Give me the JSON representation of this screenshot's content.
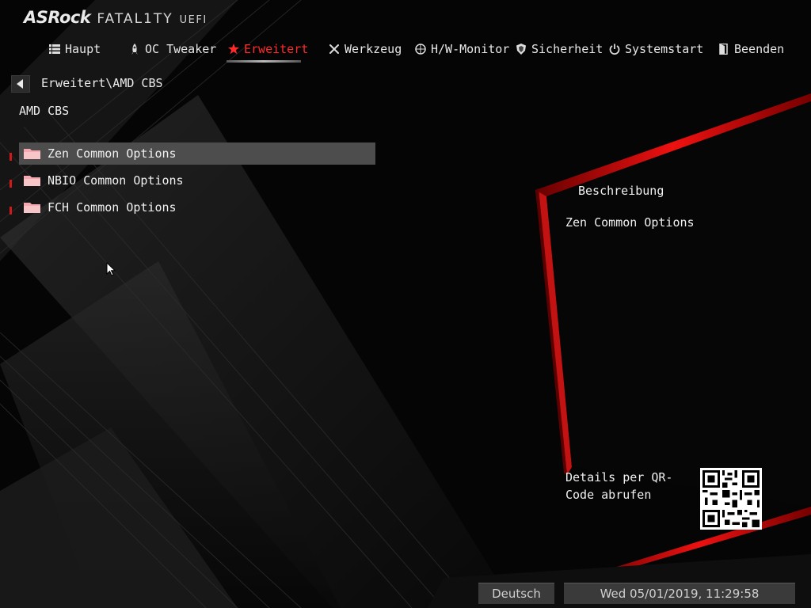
{
  "logo": {
    "brand": "ASRock",
    "line": "FATAL1TY",
    "sub": "UEFI"
  },
  "tabs": [
    {
      "label": "Haupt",
      "icon": "list-icon"
    },
    {
      "label": "OC Tweaker",
      "icon": "rocket-icon"
    },
    {
      "label": "Erweitert",
      "icon": "star-icon",
      "active": true
    },
    {
      "label": "Werkzeug",
      "icon": "tools-icon"
    },
    {
      "label": "H/W-Monitor",
      "icon": "monitor-icon"
    },
    {
      "label": "Sicherheit",
      "icon": "shield-icon"
    },
    {
      "label": "Systemstart",
      "icon": "power-icon"
    },
    {
      "label": "Beenden",
      "icon": "exit-icon"
    }
  ],
  "breadcrumb": "Erweitert\\AMD CBS",
  "page_title": "AMD CBS",
  "menu": [
    {
      "label": "Zen Common Options",
      "selected": true
    },
    {
      "label": "NBIO Common Options"
    },
    {
      "label": "FCH Common Options"
    }
  ],
  "description": {
    "title": "Beschreibung",
    "text": "Zen Common Options",
    "qr_text": "Details per QR-Code abrufen"
  },
  "footer": {
    "language": "Deutsch",
    "datetime": "Wed 05/01/2019, 11:29:58"
  },
  "colors": {
    "accent": "#ff2a2a",
    "selected_bg": "#4d4d4d",
    "folder": "#f4a9b0",
    "background": "#050505"
  }
}
